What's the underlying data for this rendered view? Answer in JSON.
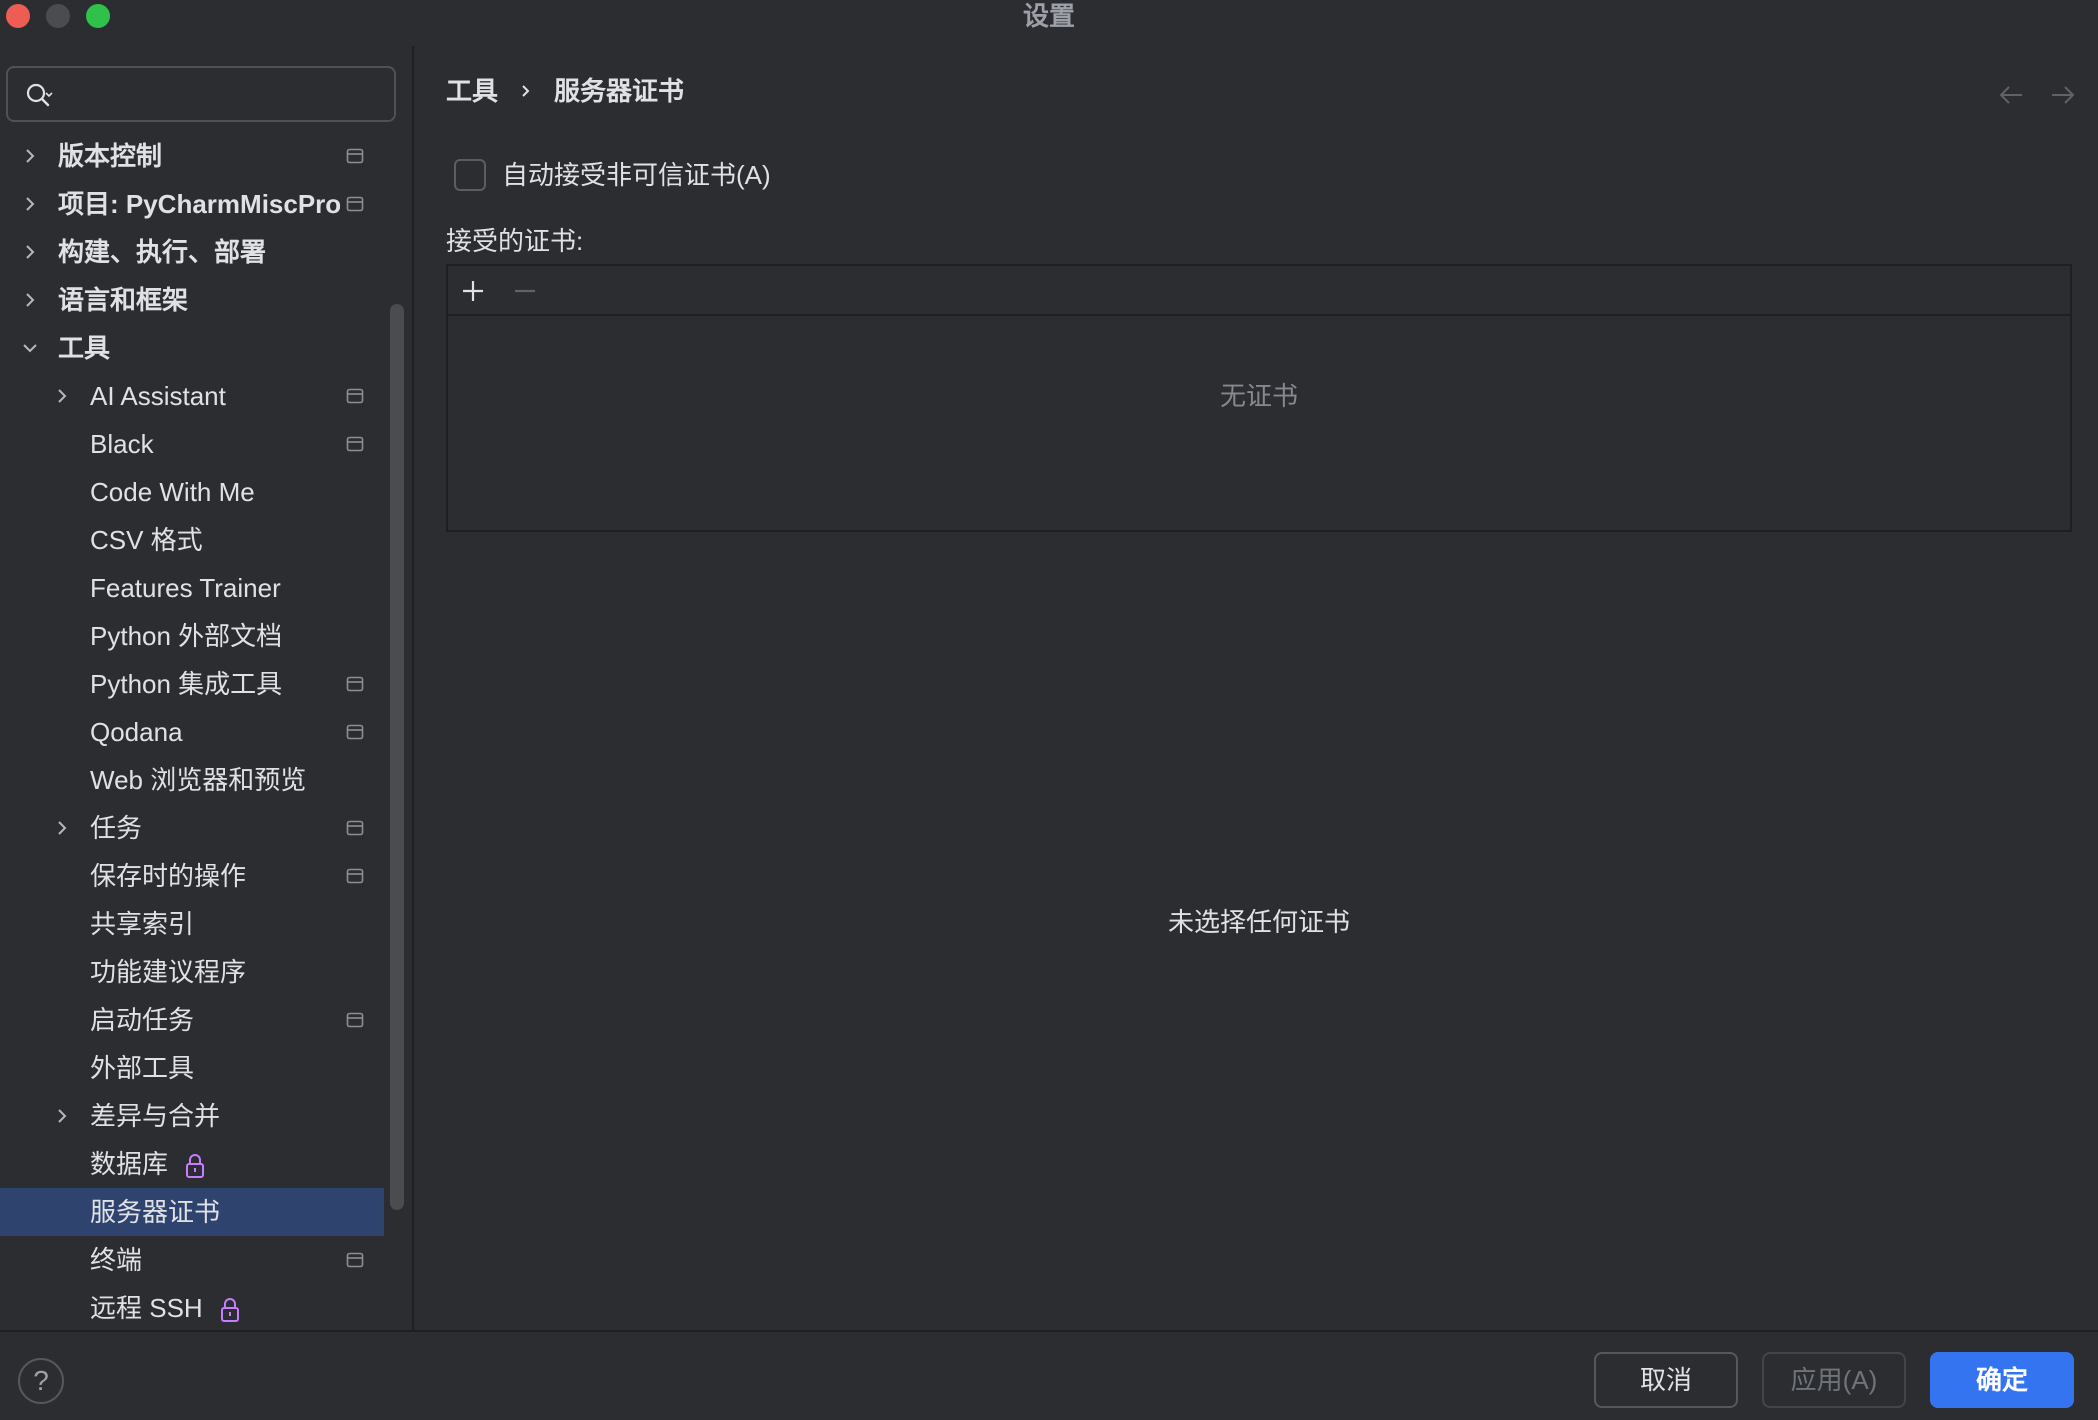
{
  "window": {
    "title": "设置"
  },
  "search": {
    "placeholder": "",
    "value": ""
  },
  "sidebar": {
    "items": [
      {
        "label": "版本控制",
        "level": 0,
        "expander": "collapsed",
        "project_icon": true
      },
      {
        "label": "项目: PyCharmMiscProject",
        "level": 0,
        "expander": "collapsed",
        "project_icon": true
      },
      {
        "label": "构建、执行、部署",
        "level": 0,
        "expander": "collapsed",
        "project_icon": false
      },
      {
        "label": "语言和框架",
        "level": 0,
        "expander": "collapsed",
        "project_icon": false
      },
      {
        "label": "工具",
        "level": 0,
        "expander": "expanded",
        "project_icon": false
      },
      {
        "label": "AI Assistant",
        "level": 1,
        "expander": "collapsed",
        "project_icon": true
      },
      {
        "label": "Black",
        "level": 1,
        "expander": "none",
        "project_icon": true
      },
      {
        "label": "Code With Me",
        "level": 1,
        "expander": "none",
        "project_icon": false
      },
      {
        "label": "CSV 格式",
        "level": 1,
        "expander": "none",
        "project_icon": false
      },
      {
        "label": "Features Trainer",
        "level": 1,
        "expander": "none",
        "project_icon": false
      },
      {
        "label": "Python 外部文档",
        "level": 1,
        "expander": "none",
        "project_icon": false
      },
      {
        "label": "Python 集成工具",
        "level": 1,
        "expander": "none",
        "project_icon": true
      },
      {
        "label": "Qodana",
        "level": 1,
        "expander": "none",
        "project_icon": true
      },
      {
        "label": "Web 浏览器和预览",
        "level": 1,
        "expander": "none",
        "project_icon": false
      },
      {
        "label": "任务",
        "level": 1,
        "expander": "collapsed",
        "project_icon": true
      },
      {
        "label": "保存时的操作",
        "level": 1,
        "expander": "none",
        "project_icon": true
      },
      {
        "label": "共享索引",
        "level": 1,
        "expander": "none",
        "project_icon": false
      },
      {
        "label": "功能建议程序",
        "level": 1,
        "expander": "none",
        "project_icon": false
      },
      {
        "label": "启动任务",
        "level": 1,
        "expander": "none",
        "project_icon": true
      },
      {
        "label": "外部工具",
        "level": 1,
        "expander": "none",
        "project_icon": false
      },
      {
        "label": "差异与合并",
        "level": 1,
        "expander": "collapsed",
        "project_icon": false
      },
      {
        "label": "数据库",
        "level": 1,
        "expander": "none",
        "project_icon": false,
        "lock": true
      },
      {
        "label": "服务器证书",
        "level": 1,
        "expander": "none",
        "project_icon": false,
        "selected": true
      },
      {
        "label": "终端",
        "level": 1,
        "expander": "none",
        "project_icon": true
      },
      {
        "label": "远程 SSH",
        "level": 1,
        "expander": "none",
        "project_icon": false,
        "lock": true
      }
    ]
  },
  "breadcrumb": {
    "parent": "工具",
    "current": "服务器证书"
  },
  "main": {
    "auto_accept_label": "自动接受非可信证书(A)",
    "auto_accept_checked": false,
    "accepted_label": "接受的证书:",
    "empty_list_text": "无证书",
    "no_selection_text": "未选择任何证书"
  },
  "footer": {
    "help": "?",
    "cancel": "取消",
    "apply": "应用(A)",
    "ok": "确定"
  },
  "colors": {
    "background": "#2b2d30",
    "selection": "#2e436e",
    "accent": "#3574f0",
    "lock": "#c77dff"
  }
}
